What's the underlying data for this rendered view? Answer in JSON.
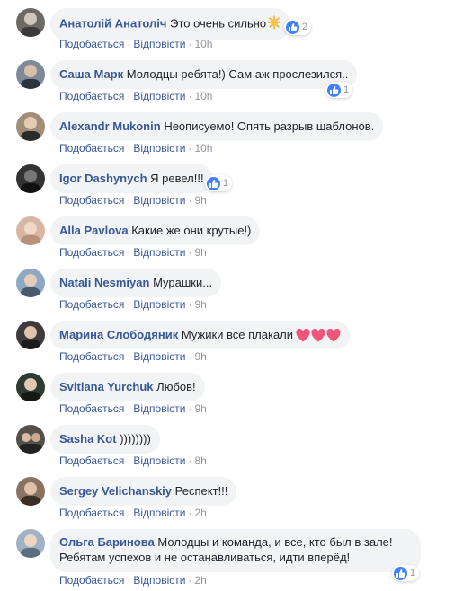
{
  "labels": {
    "like": "Подобається",
    "reply": "Відповісти",
    "sep": "·"
  },
  "colors": {
    "author": "#385898",
    "bubble": "#f2f3f5",
    "meta": "#90949c",
    "like": "#4080ff"
  },
  "comments": [
    {
      "author": "Анатолій Анатоліч",
      "text": "Это очень сильно",
      "emoji": "sun-icon",
      "time": "10h",
      "likes": "2",
      "avatar_bg": "#6d6a66"
    },
    {
      "author": "Саша Марк",
      "text": "Молодцы ребята!) Сам аж прослезился..",
      "time": "10h",
      "likes": "1",
      "avatar_bg": "#7f8a99"
    },
    {
      "author": "Alexandr Mukonin",
      "text": "Неописуемо! Опять разрыв шаблонов.",
      "time": "10h",
      "avatar_bg": "#a08e78"
    },
    {
      "author": "Igor Dashynych",
      "text": "Я ревел!!!",
      "time": "9h",
      "likes": "1",
      "avatar_bg": "#333333"
    },
    {
      "author": "Alla Pavlova",
      "text": "Какие же они крутые!)",
      "time": "9h",
      "avatar_bg": "#d8b6a4"
    },
    {
      "author": "Natali Nesmiyan",
      "text": "Мурашки...",
      "time": "9h",
      "avatar_bg": "#8fa9c4"
    },
    {
      "author": "Марина Слободяник",
      "text": "Мужики все плакали",
      "emoji": "hearts",
      "time": "9h",
      "avatar_bg": "#3f3a3c"
    },
    {
      "author": "Svitlana Yurchuk",
      "text": "Любов!",
      "time": "9h",
      "avatar_bg": "#2f3a30"
    },
    {
      "author": "Sasha Kot",
      "text": "))))))))",
      "time": "8h",
      "avatar_bg": "#555049"
    },
    {
      "author": "Sergey Velichanskiy",
      "text": "Респект!!!",
      "time": "2h",
      "avatar_bg": "#8a7262"
    },
    {
      "author": "Ольга Баринова",
      "text": "Молодцы и команда, и все, кто был в зале!",
      "text2": "Ребятам успехов и не останавливаться, идти вперёд!",
      "time": "2h",
      "likes": "1",
      "avatar_bg": "#9fb3c4"
    }
  ]
}
